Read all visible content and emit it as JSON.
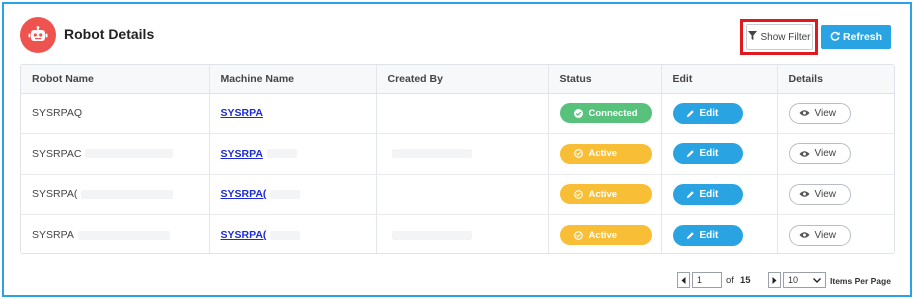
{
  "header": {
    "title": "Robot Details",
    "show_filter_label": "Show Filter",
    "refresh_label": "Refresh"
  },
  "table": {
    "columns": [
      "Robot Name",
      "Machine Name",
      "Created By",
      "Status",
      "Edit",
      "Details"
    ],
    "rows": [
      {
        "robot_name": "SYSRPAQ",
        "machine_name": "SYSRPA",
        "created_by": "",
        "status": "Connected",
        "edit": "Edit",
        "details": "View"
      },
      {
        "robot_name": "SYSRPAC",
        "machine_name": "SYSRPA",
        "created_by": "",
        "status": "Active",
        "edit": "Edit",
        "details": "View"
      },
      {
        "robot_name": "SYSRPA(",
        "machine_name": "SYSRPA(",
        "created_by": "",
        "status": "Active",
        "edit": "Edit",
        "details": "View"
      },
      {
        "robot_name": "SYSRPA",
        "machine_name": "SYSRPA(",
        "created_by": "",
        "status": "Active",
        "edit": "Edit",
        "details": "View"
      }
    ]
  },
  "pagination": {
    "current_page": "1",
    "of_label": "of",
    "total_pages": "15",
    "per_page": "10",
    "per_page_label": "Items Per Page"
  },
  "icons": {
    "avatar": "robot-icon",
    "filter": "filter-icon",
    "refresh": "refresh-icon",
    "status_connected": "check-circle-icon",
    "status_active": "check-circle-icon",
    "edit": "pencil-icon",
    "view": "eye-icon"
  },
  "colors": {
    "frame_border": "#29a3e6",
    "avatar_bg": "#ef5350",
    "highlight": "#e0191f",
    "primary": "#2aa3e3",
    "connected": "#58c27d",
    "active": "#f7be36",
    "link": "#1d2bd6"
  }
}
